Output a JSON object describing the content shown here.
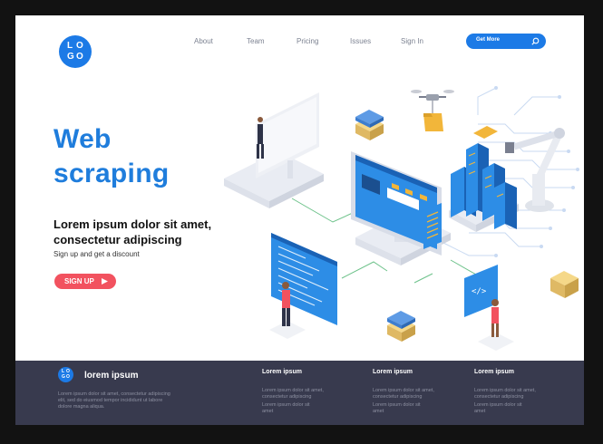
{
  "header": {
    "logo_letters": [
      "L",
      "O",
      "G",
      "O"
    ],
    "nav": [
      {
        "label": "About"
      },
      {
        "label": "Team"
      },
      {
        "label": "Pricing"
      },
      {
        "label": "Issues"
      },
      {
        "label": "Sign In"
      }
    ],
    "cta": {
      "label": "Get More",
      "icon": "search-icon"
    }
  },
  "hero": {
    "title_line1": "Web",
    "title_line2": "scraping",
    "subtitle_line1": "Lorem ipsum dolor sit amet,",
    "subtitle_line2": "consectetur adipiscing",
    "text": "Sign up and get a discount",
    "button": {
      "label": "SIGN UP",
      "icon": "arrow-right-icon"
    }
  },
  "footer": {
    "logo_letters": [
      "L",
      "O",
      "G",
      "O"
    ],
    "brand": "lorem ipsum",
    "description": "Lorem ipsum dolor sit amet, consectetur adipiscing elit, sed do eiusmod tempor incididunt ut labore dolore magna aliqua.",
    "columns": [
      {
        "heading": "Lorem ipsum",
        "line1": "Lorem ipsum dolor sit amet, consectetur adipiscing",
        "line2": "Lorem ipsum dolor sit amet"
      },
      {
        "heading": "Lorem ipsum",
        "line1": "Lorem ipsum dolor sit amet, consectetur adipiscing",
        "line2": "Lorem ipsum dolor sit amet"
      },
      {
        "heading": "Lorem ipsum",
        "line1": "Lorem ipsum dolor sit amet, consectetur adipiscing",
        "line2": "Lorem ipsum dolor sit amet"
      }
    ]
  },
  "colors": {
    "brand_blue": "#1c7ae6",
    "title_blue": "#1f7ddc",
    "signup_red": "#f2525f",
    "footer_bg": "#383a4e",
    "frame_bg": "#121212"
  }
}
